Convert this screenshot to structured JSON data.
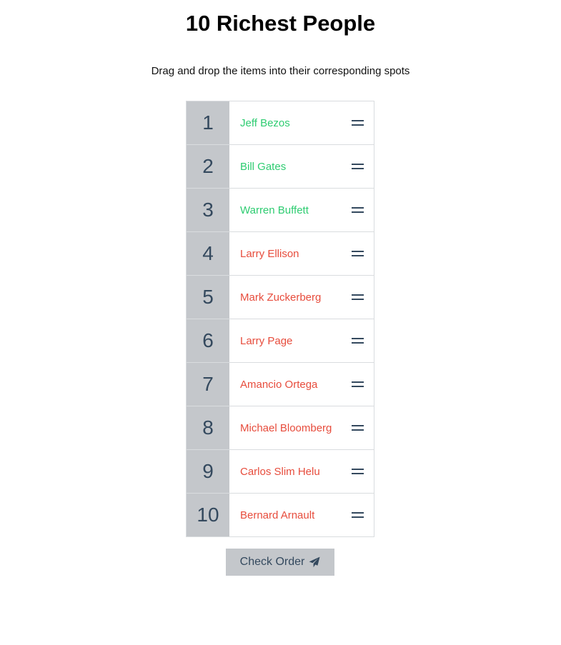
{
  "title": "10 Richest People",
  "subtitle": "Drag and drop the items into their corresponding spots",
  "items": [
    {
      "rank": "1",
      "name": "Jeff Bezos",
      "status": "correct"
    },
    {
      "rank": "2",
      "name": "Bill Gates",
      "status": "correct"
    },
    {
      "rank": "3",
      "name": "Warren Buffett",
      "status": "correct"
    },
    {
      "rank": "4",
      "name": "Larry Ellison",
      "status": "wrong"
    },
    {
      "rank": "5",
      "name": "Mark Zuckerberg",
      "status": "wrong"
    },
    {
      "rank": "6",
      "name": "Larry Page",
      "status": "wrong"
    },
    {
      "rank": "7",
      "name": "Amancio Ortega",
      "status": "wrong"
    },
    {
      "rank": "8",
      "name": "Michael Bloomberg",
      "status": "wrong"
    },
    {
      "rank": "9",
      "name": "Carlos Slim Helu",
      "status": "wrong"
    },
    {
      "rank": "10",
      "name": "Bernard Arnault",
      "status": "wrong"
    }
  ],
  "button": {
    "label": "Check Order",
    "icon": "paper-plane-icon"
  },
  "colors": {
    "correct": "#2ecc71",
    "wrong": "#e74c3c",
    "number_bg": "#c4c7cb",
    "text_dark": "#34495e"
  }
}
